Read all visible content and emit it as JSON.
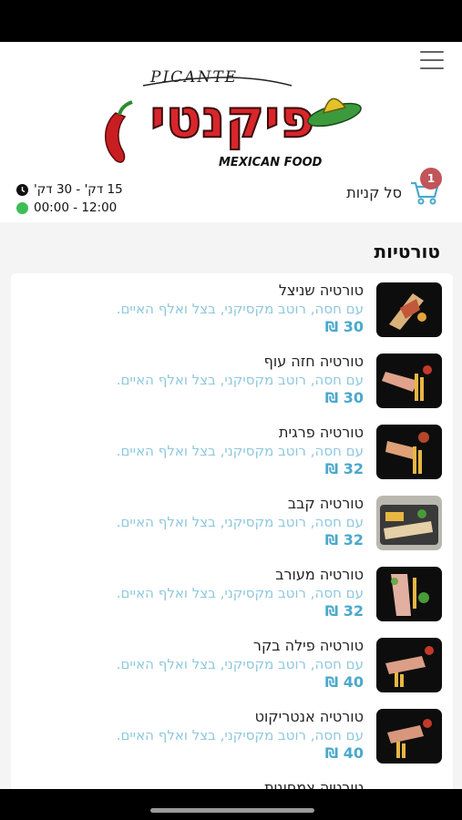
{
  "header": {
    "logo_text": "פיקנטי",
    "logo_arc_text": "PICANTE",
    "logo_sub_text": "MEXICAN FOOD",
    "cart_label": "סל קניות",
    "cart_count": "1",
    "delivery_time": "15 דק' - 30 דק'",
    "opening_hours": "00:00 - 12:00"
  },
  "section": {
    "title": "טורטיות"
  },
  "items": [
    {
      "name": "טורטיה שניצל",
      "desc": "עם חסה, רוטב מקסיקני, בצל ואלף האיים.",
      "price": "30 ₪"
    },
    {
      "name": "טורטיה חזה עוף",
      "desc": "עם חסה, רוטב מקסיקני, בצל ואלף האיים.",
      "price": "30 ₪"
    },
    {
      "name": "טורטיה פרגית",
      "desc": "עם חסה, רוטב מקסיקני, בצל ואלף האיים.",
      "price": "32 ₪"
    },
    {
      "name": "טורטיה קבב",
      "desc": "עם חסה, רוטב מקסיקני, בצל ואלף האיים.",
      "price": "32 ₪"
    },
    {
      "name": "טורטיה מעורב",
      "desc": "עם חסה, רוטב מקסיקני, בצל ואלף האיים.",
      "price": "32 ₪"
    },
    {
      "name": "טורטיה פילה בקר",
      "desc": "עם חסה, רוטב מקסיקני, בצל ואלף האיים.",
      "price": "40 ₪"
    },
    {
      "name": "טורטיה אנטריקוט",
      "desc": "עם חסה, רוטב מקסיקני, בצל ואלף האיים.",
      "price": "40 ₪"
    },
    {
      "name": "טורטיה צמחונית",
      "desc": "",
      "price": ""
    }
  ],
  "colors": {
    "accent": "#4aa8cc",
    "desc": "#8fc8dd",
    "badge": "#c0555a",
    "open": "#3dbf55",
    "logo_red": "#d8262b"
  }
}
